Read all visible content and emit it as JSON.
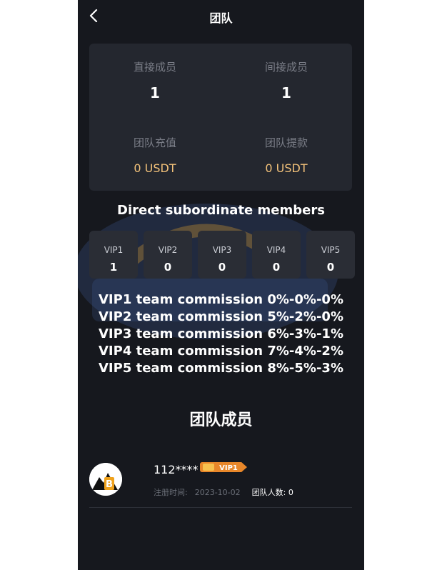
{
  "header": {
    "title": "团队",
    "back_icon": "chevron-left-icon"
  },
  "stats": {
    "direct_label": "直接成员",
    "direct_value": "1",
    "indirect_label": "间接成员",
    "indirect_value": "1",
    "recharge_label": "团队充值",
    "recharge_value": "0 USDT",
    "withdraw_label": "团队提款",
    "withdraw_value": "0 USDT",
    "gold_color": "#f3c27a"
  },
  "subordinates": {
    "title": "Direct subordinate members",
    "levels": [
      {
        "name": "VIP1",
        "count": "1"
      },
      {
        "name": "VIP2",
        "count": "0"
      },
      {
        "name": "VIP3",
        "count": "0"
      },
      {
        "name": "VIP4",
        "count": "0"
      },
      {
        "name": "VIP5",
        "count": "0"
      }
    ]
  },
  "commissions": [
    "VIP1 team commission 0%-0%-0%",
    "VIP2 team commission 5%-2%-0%",
    "VIP3 team commission 6%-3%-1%",
    "VIP4 team commission 7%-4%-2%",
    "VIP5 team commission 8%-5%-3%"
  ],
  "members": {
    "title": "团队成员",
    "list": [
      {
        "name": "112****",
        "vip_badge": "VIP1",
        "reg_label": "注册时间:",
        "reg_date": "2023-10-02",
        "team_count_label": "团队人数:",
        "team_count": "0"
      }
    ]
  }
}
